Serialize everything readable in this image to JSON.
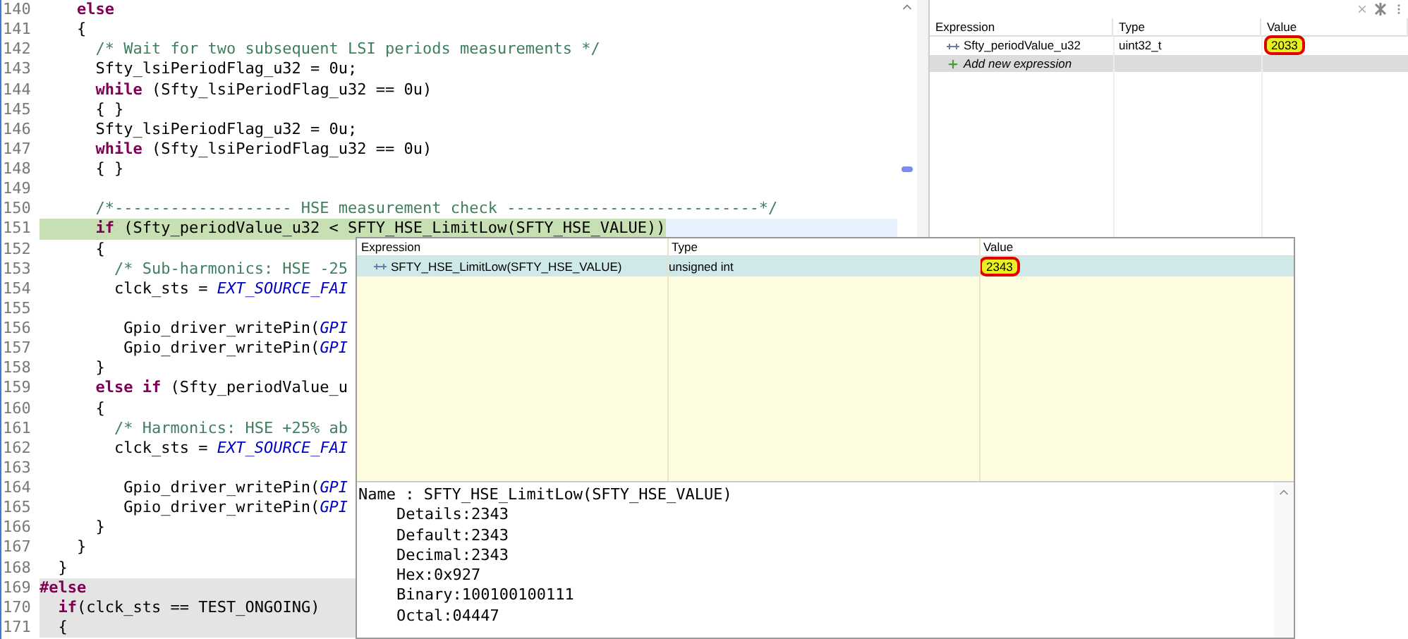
{
  "editor": {
    "lines": [
      {
        "number": "140",
        "kind": "normal",
        "segments": [
          {
            "kind": "keyword",
            "text": "    else"
          }
        ]
      },
      {
        "number": "141",
        "kind": "normal",
        "segments": [
          {
            "kind": "plain",
            "text": "    {"
          }
        ]
      },
      {
        "number": "142",
        "kind": "normal",
        "segments": [
          {
            "kind": "comment",
            "text": "      /* Wait for two subsequent LSI periods measurements */"
          }
        ]
      },
      {
        "number": "143",
        "kind": "normal",
        "segments": [
          {
            "kind": "plain",
            "text": "      Sfty_lsiPeriodFlag_u32 = 0u;"
          }
        ]
      },
      {
        "number": "144",
        "kind": "normal",
        "segments": [
          {
            "kind": "keyword",
            "text": "      while"
          },
          {
            "kind": "plain",
            "text": " (Sfty_lsiPeriodFlag_u32 == 0u)"
          }
        ]
      },
      {
        "number": "145",
        "kind": "normal",
        "segments": [
          {
            "kind": "plain",
            "text": "      { }"
          }
        ]
      },
      {
        "number": "146",
        "kind": "normal",
        "segments": [
          {
            "kind": "plain",
            "text": "      Sfty_lsiPeriodFlag_u32 = 0u;"
          }
        ]
      },
      {
        "number": "147",
        "kind": "normal",
        "segments": [
          {
            "kind": "keyword",
            "text": "      while"
          },
          {
            "kind": "plain",
            "text": " (Sfty_lsiPeriodFlag_u32 == 0u)"
          }
        ]
      },
      {
        "number": "148",
        "kind": "normal",
        "segments": [
          {
            "kind": "plain",
            "text": "      { }"
          }
        ]
      },
      {
        "number": "149",
        "kind": "normal"
      },
      {
        "number": "150",
        "kind": "normal",
        "segments": [
          {
            "kind": "comment",
            "text": "      /*------------------- HSE measurement check ---------------------------*/"
          }
        ]
      },
      {
        "number": "151",
        "kind": "current",
        "segments": [
          {
            "kind": "keyword",
            "text": "      if"
          },
          {
            "kind": "plain",
            "text": " (Sfty_periodValue_u32 < SFTY_HSE_LimitLow(SFTY_HSE_VALUE))"
          }
        ]
      },
      {
        "number": "152",
        "kind": "normal",
        "segments": [
          {
            "kind": "plain",
            "text": "      {"
          }
        ]
      },
      {
        "number": "153",
        "kind": "normal",
        "segments": [
          {
            "kind": "comment",
            "text": "        /* Sub-harmonics: HSE -25"
          }
        ]
      },
      {
        "number": "154",
        "kind": "normal",
        "segments": [
          {
            "kind": "plain",
            "text": "        clck_sts = "
          },
          {
            "kind": "constant",
            "text": "EXT_SOURCE_FAI"
          }
        ]
      },
      {
        "number": "155",
        "kind": "normal"
      },
      {
        "number": "156",
        "kind": "normal",
        "segments": [
          {
            "kind": "plain",
            "text": "         Gpio_driver_writePin("
          },
          {
            "kind": "constant",
            "text": "GPI"
          }
        ]
      },
      {
        "number": "157",
        "kind": "normal",
        "segments": [
          {
            "kind": "plain",
            "text": "         Gpio_driver_writePin("
          },
          {
            "kind": "constant",
            "text": "GPI"
          }
        ]
      },
      {
        "number": "158",
        "kind": "normal",
        "segments": [
          {
            "kind": "plain",
            "text": "      }"
          }
        ]
      },
      {
        "number": "159",
        "kind": "normal",
        "segments": [
          {
            "kind": "keyword",
            "text": "      else if"
          },
          {
            "kind": "plain",
            "text": " (Sfty_periodValue_u"
          }
        ]
      },
      {
        "number": "160",
        "kind": "normal",
        "segments": [
          {
            "kind": "plain",
            "text": "      {"
          }
        ]
      },
      {
        "number": "161",
        "kind": "normal",
        "segments": [
          {
            "kind": "comment",
            "text": "        /* Harmonics: HSE +25% ab"
          }
        ]
      },
      {
        "number": "162",
        "kind": "normal",
        "segments": [
          {
            "kind": "plain",
            "text": "        clck_sts = "
          },
          {
            "kind": "constant",
            "text": "EXT_SOURCE_FAI"
          }
        ]
      },
      {
        "number": "163",
        "kind": "normal"
      },
      {
        "number": "164",
        "kind": "normal",
        "segments": [
          {
            "kind": "plain",
            "text": "         Gpio_driver_writePin("
          },
          {
            "kind": "constant",
            "text": "GPI"
          }
        ]
      },
      {
        "number": "165",
        "kind": "normal",
        "segments": [
          {
            "kind": "plain",
            "text": "         Gpio_driver_writePin("
          },
          {
            "kind": "constant",
            "text": "GPI"
          }
        ]
      },
      {
        "number": "166",
        "kind": "normal",
        "segments": [
          {
            "kind": "plain",
            "text": "      }"
          }
        ]
      },
      {
        "number": "167",
        "kind": "normal",
        "segments": [
          {
            "kind": "plain",
            "text": "    }"
          }
        ]
      },
      {
        "number": "168",
        "kind": "normal",
        "segments": [
          {
            "kind": "plain",
            "text": "  }"
          }
        ]
      },
      {
        "number": "169",
        "kind": "inactive",
        "segments": [
          {
            "kind": "preproc",
            "text": "#else"
          }
        ]
      },
      {
        "number": "170",
        "kind": "inactive",
        "segments": [
          {
            "kind": "keyword",
            "text": "  if"
          },
          {
            "kind": "plain",
            "text": "(clck_sts == TEST_ONGOING)"
          }
        ]
      },
      {
        "number": "171",
        "kind": "inactive",
        "segments": [
          {
            "kind": "plain",
            "text": "  {"
          }
        ]
      }
    ]
  },
  "expressions_view": {
    "columns": [
      "Expression",
      "Type",
      "Value"
    ],
    "rows": [
      {
        "expression": "Sfty_periodValue_u32",
        "type": "uint32_t",
        "value": "2033",
        "marked": true
      }
    ],
    "add_row": "Add new expression"
  },
  "hover_popup": {
    "columns": [
      "Expression",
      "Type",
      "Value"
    ],
    "rows": [
      {
        "expression": "SFTY_HSE_LimitLow(SFTY_HSE_VALUE)",
        "type": "unsigned int",
        "value": "2343",
        "selected": true,
        "marked": true
      }
    ],
    "details": {
      "name_line": "Name : SFTY_HSE_LimitLow(SFTY_HSE_VALUE)",
      "fields": [
        "Details:2343",
        "Default:2343",
        "Decimal:2343",
        "Hex:0x927",
        "Binary:100100100111",
        "Octal:04447"
      ]
    }
  }
}
